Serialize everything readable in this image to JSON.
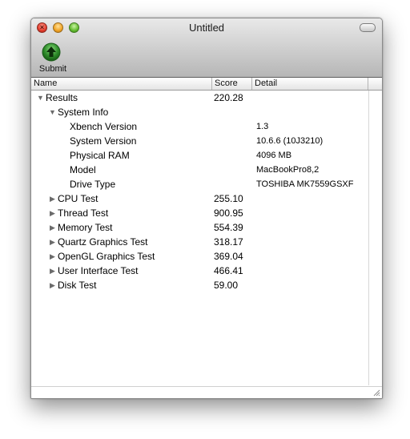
{
  "window": {
    "title": "Untitled"
  },
  "toolbar": {
    "submit_label": "Submit"
  },
  "columns": {
    "name": "Name",
    "score": "Score",
    "detail": "Detail"
  },
  "rows": [
    {
      "name": "Results",
      "score": "220.28",
      "detail": "",
      "expanded": true
    },
    {
      "name": "System Info",
      "score": "",
      "detail": "",
      "expanded": true
    },
    {
      "name": "Xbench Version",
      "score": "",
      "detail": "1.3"
    },
    {
      "name": "System Version",
      "score": "",
      "detail": "10.6.6 (10J3210)"
    },
    {
      "name": "Physical RAM",
      "score": "",
      "detail": "4096 MB"
    },
    {
      "name": "Model",
      "score": "",
      "detail": "MacBookPro8,2"
    },
    {
      "name": "Drive Type",
      "score": "",
      "detail": "TOSHIBA MK7559GSXF"
    },
    {
      "name": "CPU Test",
      "score": "255.10",
      "detail": "",
      "expanded": false
    },
    {
      "name": "Thread Test",
      "score": "900.95",
      "detail": "",
      "expanded": false
    },
    {
      "name": "Memory Test",
      "score": "554.39",
      "detail": "",
      "expanded": false
    },
    {
      "name": "Quartz Graphics Test",
      "score": "318.17",
      "detail": "",
      "expanded": false
    },
    {
      "name": "OpenGL Graphics Test",
      "score": "369.04",
      "detail": "",
      "expanded": false
    },
    {
      "name": "User Interface Test",
      "score": "466.41",
      "detail": "",
      "expanded": false
    },
    {
      "name": "Disk Test",
      "score": "59.00",
      "detail": "",
      "expanded": false
    }
  ],
  "icons": {
    "submit": "up-arrow-circle-icon",
    "collapsed": "disclosure-triangle-right-icon",
    "expanded": "disclosure-triangle-down-icon"
  },
  "colors": {
    "submit_icon": "#2e8b2a",
    "close_button": "#e23b2b",
    "minimize_button": "#f0a325",
    "zoom_button": "#62bb2f"
  }
}
